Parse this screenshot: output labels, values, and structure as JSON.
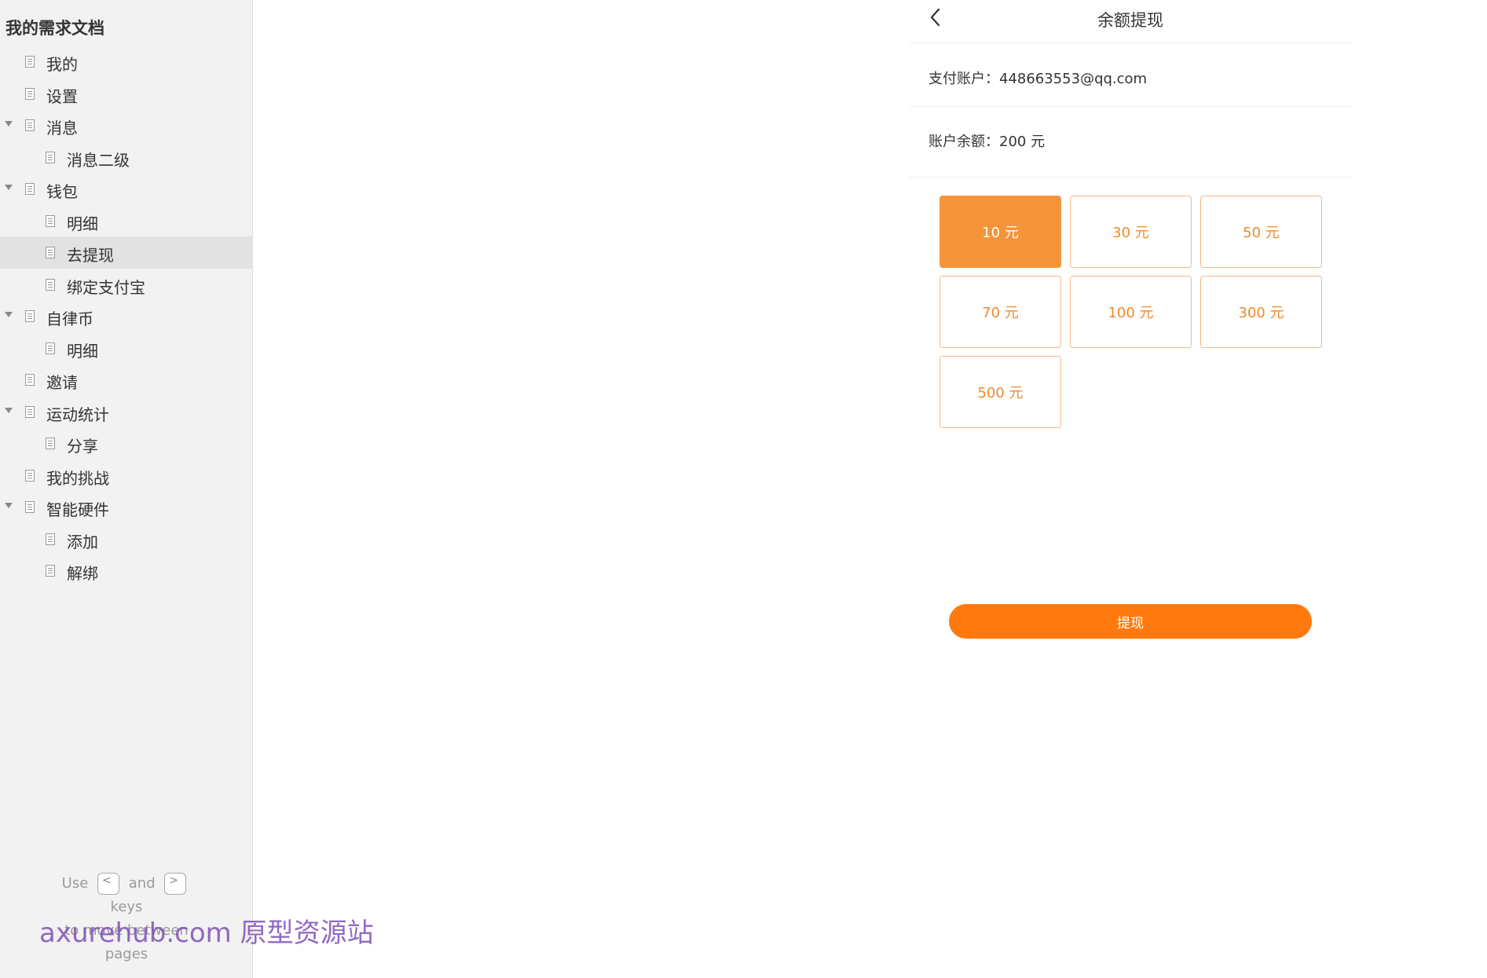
{
  "sidebar": {
    "title": "我的需求文档",
    "items": [
      {
        "label": "我的"
      },
      {
        "label": "设置"
      },
      {
        "label": "消息"
      },
      {
        "label": "消息二级"
      },
      {
        "label": "钱包"
      },
      {
        "label": "明细"
      },
      {
        "label": "去提现"
      },
      {
        "label": "绑定支付宝"
      },
      {
        "label": "自律币"
      },
      {
        "label": "明细"
      },
      {
        "label": "邀请"
      },
      {
        "label": "运动统计"
      },
      {
        "label": "分享"
      },
      {
        "label": "我的挑战"
      },
      {
        "label": "智能硬件"
      },
      {
        "label": "添加"
      },
      {
        "label": "解绑"
      }
    ],
    "selected_label": "去提现",
    "hint": {
      "use": "Use",
      "prev_key": "<",
      "and": "and",
      "next_key": ">",
      "keys": "keys",
      "line2": "to move between",
      "line3": "pages"
    }
  },
  "watermark": "axurehub.com 原型资源站",
  "page": {
    "title": "余额提现",
    "account_text": "支付账户：448663553@qq.com",
    "balance_text": "账户余额：200 元",
    "amounts": [
      "10 元",
      "30 元",
      "50 元",
      "70 元",
      "100 元",
      "300 元",
      "500 元"
    ],
    "selected_amount": "10 元",
    "submit_label": "提现"
  },
  "colors": {
    "accent": "#ff7a0e",
    "selected_amount_bg": "#f6943a",
    "amount_text": "#f08a2c"
  }
}
